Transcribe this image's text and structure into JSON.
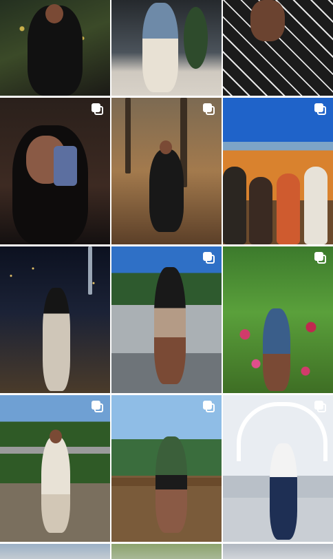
{
  "grid": {
    "tiles": [
      {
        "id": "night-lights-coat",
        "multi": false,
        "colors": [
          "#1c2418",
          "#3d4a2a",
          "#0f0f0f"
        ]
      },
      {
        "id": "balcony-denim-top",
        "multi": false,
        "colors": [
          "#2b2f33",
          "#6f7a86",
          "#c9c4bb"
        ]
      },
      {
        "id": "patterned-cape",
        "multi": false,
        "colors": [
          "#1b1b1b",
          "#e8e8e8",
          "#3a3a3a"
        ]
      },
      {
        "id": "horns-mirror-selfie",
        "multi": true,
        "colors": [
          "#2a1e1a",
          "#8a5a45",
          "#0c0c0c"
        ]
      },
      {
        "id": "autumn-forest-sitting",
        "multi": true,
        "colors": [
          "#5b4330",
          "#a37a4d",
          "#1b1b1b"
        ]
      },
      {
        "id": "fall-valley-group",
        "multi": true,
        "colors": [
          "#2f6fd0",
          "#d07a2a",
          "#3a2b20"
        ]
      },
      {
        "id": "city-night-balcony",
        "multi": false,
        "colors": [
          "#0e1220",
          "#4a3b2a",
          "#c9c2b5"
        ]
      },
      {
        "id": "lake-railing",
        "multi": true,
        "colors": [
          "#3d74b8",
          "#2f5a2d",
          "#6d6f72"
        ]
      },
      {
        "id": "flower-garden",
        "multi": true,
        "colors": [
          "#5aa03b",
          "#d13b6b",
          "#3a5e8a"
        ]
      },
      {
        "id": "treetop-walk",
        "multi": true,
        "colors": [
          "#3c6e2e",
          "#6e9bd0",
          "#8f8f8f"
        ]
      },
      {
        "id": "lookout-deck",
        "multi": true,
        "colors": [
          "#6fa4d8",
          "#2f6a35",
          "#7a5b3a"
        ]
      },
      {
        "id": "white-bridge",
        "multi": true,
        "colors": [
          "#e9edf2",
          "#9ea7b1",
          "#1e2f54"
        ]
      },
      {
        "id": "partial-1",
        "multi": false,
        "colors": [
          "#9bb0c6",
          "#c3cbd2",
          "#6a7380"
        ]
      },
      {
        "id": "partial-2",
        "multi": false,
        "colors": [
          "#8ca36e",
          "#a8b896",
          "#6f7d5f"
        ]
      },
      {
        "id": "partial-3",
        "multi": false,
        "colors": [
          "#b0b7c0",
          "#d1d5da",
          "#8d939c"
        ]
      }
    ]
  }
}
